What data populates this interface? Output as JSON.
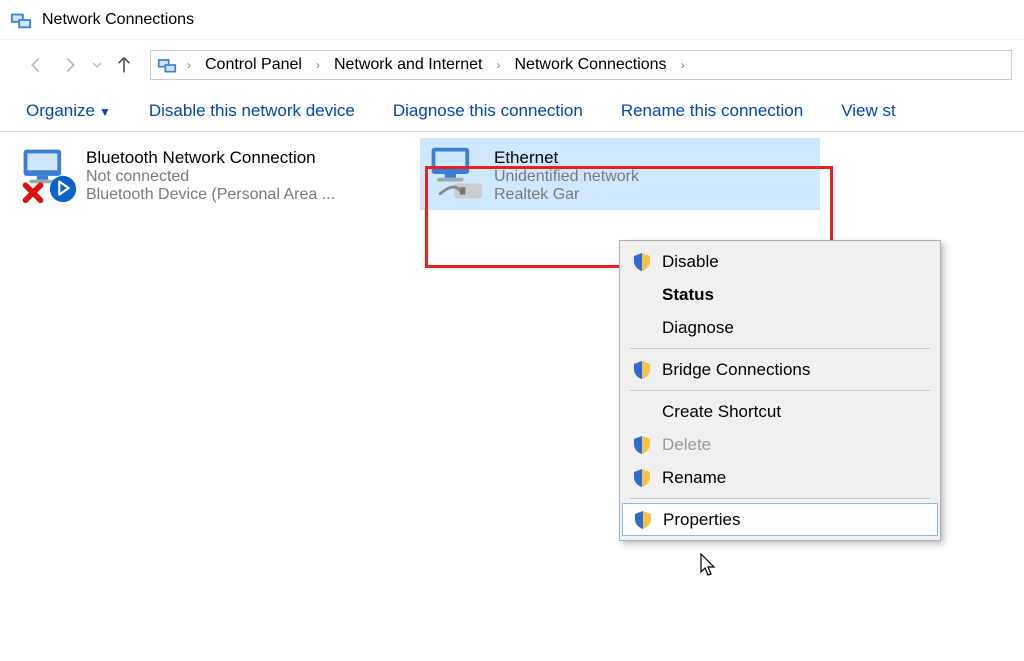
{
  "window": {
    "title": "Network Connections"
  },
  "breadcrumb": [
    "Control Panel",
    "Network and Internet",
    "Network Connections"
  ],
  "toolbar": {
    "organize": "Organize",
    "disable": "Disable this network device",
    "diagnose": "Diagnose this connection",
    "rename": "Rename this connection",
    "view": "View st"
  },
  "connections": [
    {
      "name": "Bluetooth Network Connection",
      "status": "Not connected",
      "device": "Bluetooth Device (Personal Area ..."
    },
    {
      "name": "Ethernet",
      "status": "Unidentified network",
      "device": "Realtek Gar"
    }
  ],
  "context_menu": {
    "disable": "Disable",
    "status": "Status",
    "diagnose": "Diagnose",
    "bridge": "Bridge Connections",
    "create_shortcut": "Create Shortcut",
    "delete": "Delete",
    "rename": "Rename",
    "properties": "Properties"
  }
}
